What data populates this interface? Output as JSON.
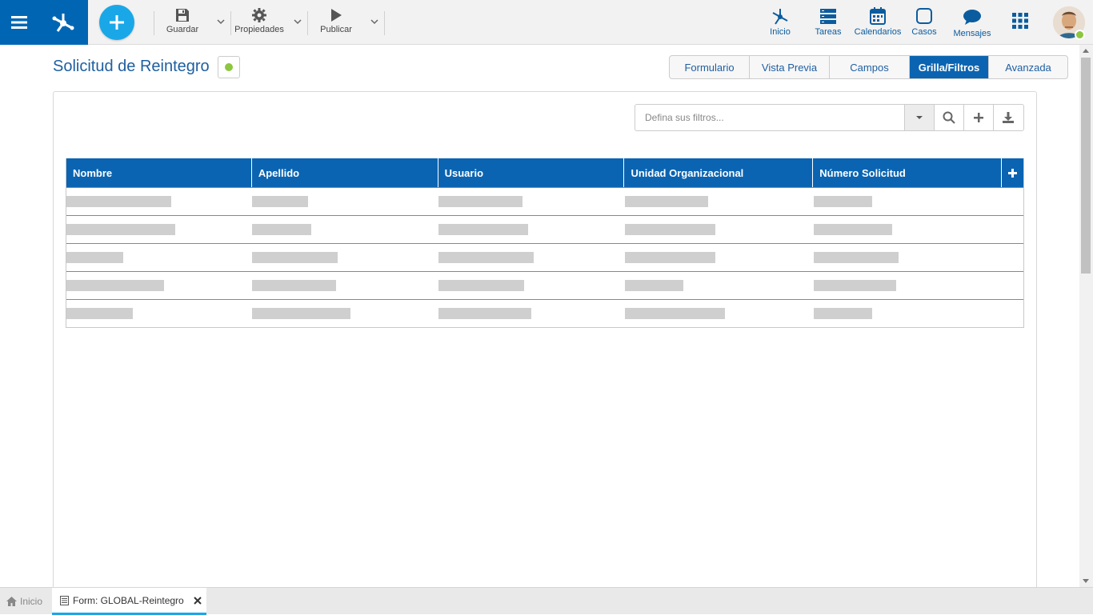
{
  "toolbar": {
    "guardar": "Guardar",
    "propiedades": "Propiedades",
    "publicar": "Publicar"
  },
  "nav": {
    "inicio": "Inicio",
    "tareas": "Tareas",
    "calendarios": "Calendarios",
    "casos": "Casos",
    "mensajes": "Mensajes"
  },
  "page": {
    "title": "Solicitud de Reintegro",
    "status_color": "#8dc63f"
  },
  "tabs": [
    {
      "label": "Formulario",
      "active": false
    },
    {
      "label": "Vista Previa",
      "active": false
    },
    {
      "label": "Campos",
      "active": false
    },
    {
      "label": "Grilla/Filtros",
      "active": true
    },
    {
      "label": "Avanzada",
      "active": false
    }
  ],
  "filter": {
    "placeholder": "Defina sus filtros..."
  },
  "grid": {
    "columns": [
      "Nombre",
      "Apellido",
      "Usuario",
      "Unidad Organizacional",
      "Número Solicitud"
    ]
  },
  "bottom_tabs": {
    "home": "Inicio",
    "form": "Form: GLOBAL-Reintegro"
  },
  "colors": {
    "brand_blue": "#0066b3",
    "accent_cyan": "#1aa7e8",
    "header_blue": "#0b64b1"
  }
}
